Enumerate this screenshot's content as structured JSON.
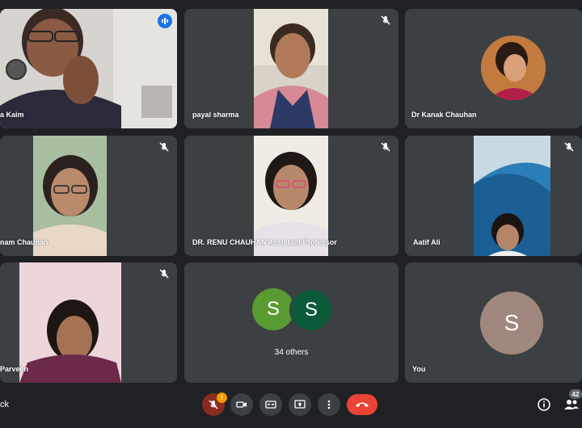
{
  "participants": [
    {
      "name": "a Kaim",
      "speaking": true
    },
    {
      "name": "payal sharma",
      "muted": true
    },
    {
      "name": "Dr Kanak Chauhan"
    },
    {
      "name": "nam Chauhan",
      "muted": true
    },
    {
      "name": "DR. RENU CHAUHAN Assistant Professor",
      "muted": true
    },
    {
      "name": "Aatif Ali",
      "muted": true
    },
    {
      "name": "Parveen",
      "muted": true
    },
    {
      "group_initial_1": "S",
      "group_initial_2": "S",
      "label": "34 others"
    },
    {
      "name": "You",
      "initial": "S"
    }
  ],
  "toolbar": {
    "left_text": "ck",
    "alert_badge": "!",
    "people_count": "42"
  },
  "colors": {
    "tile_bg": "#3c4043",
    "page_bg": "#202124",
    "active_outline": "#8ab4f8",
    "end_call": "#ea4335",
    "alert": "#f29900",
    "avatar_green": "#5a9a32",
    "avatar_dark_green": "#0b5b3a",
    "avatar_brown": "#a1887f"
  },
  "icons": [
    "mic-off-icon",
    "audio-wave-icon",
    "camera-icon",
    "captions-icon",
    "present-icon",
    "more-vert-icon",
    "hang-up-icon",
    "info-icon",
    "people-icon"
  ]
}
